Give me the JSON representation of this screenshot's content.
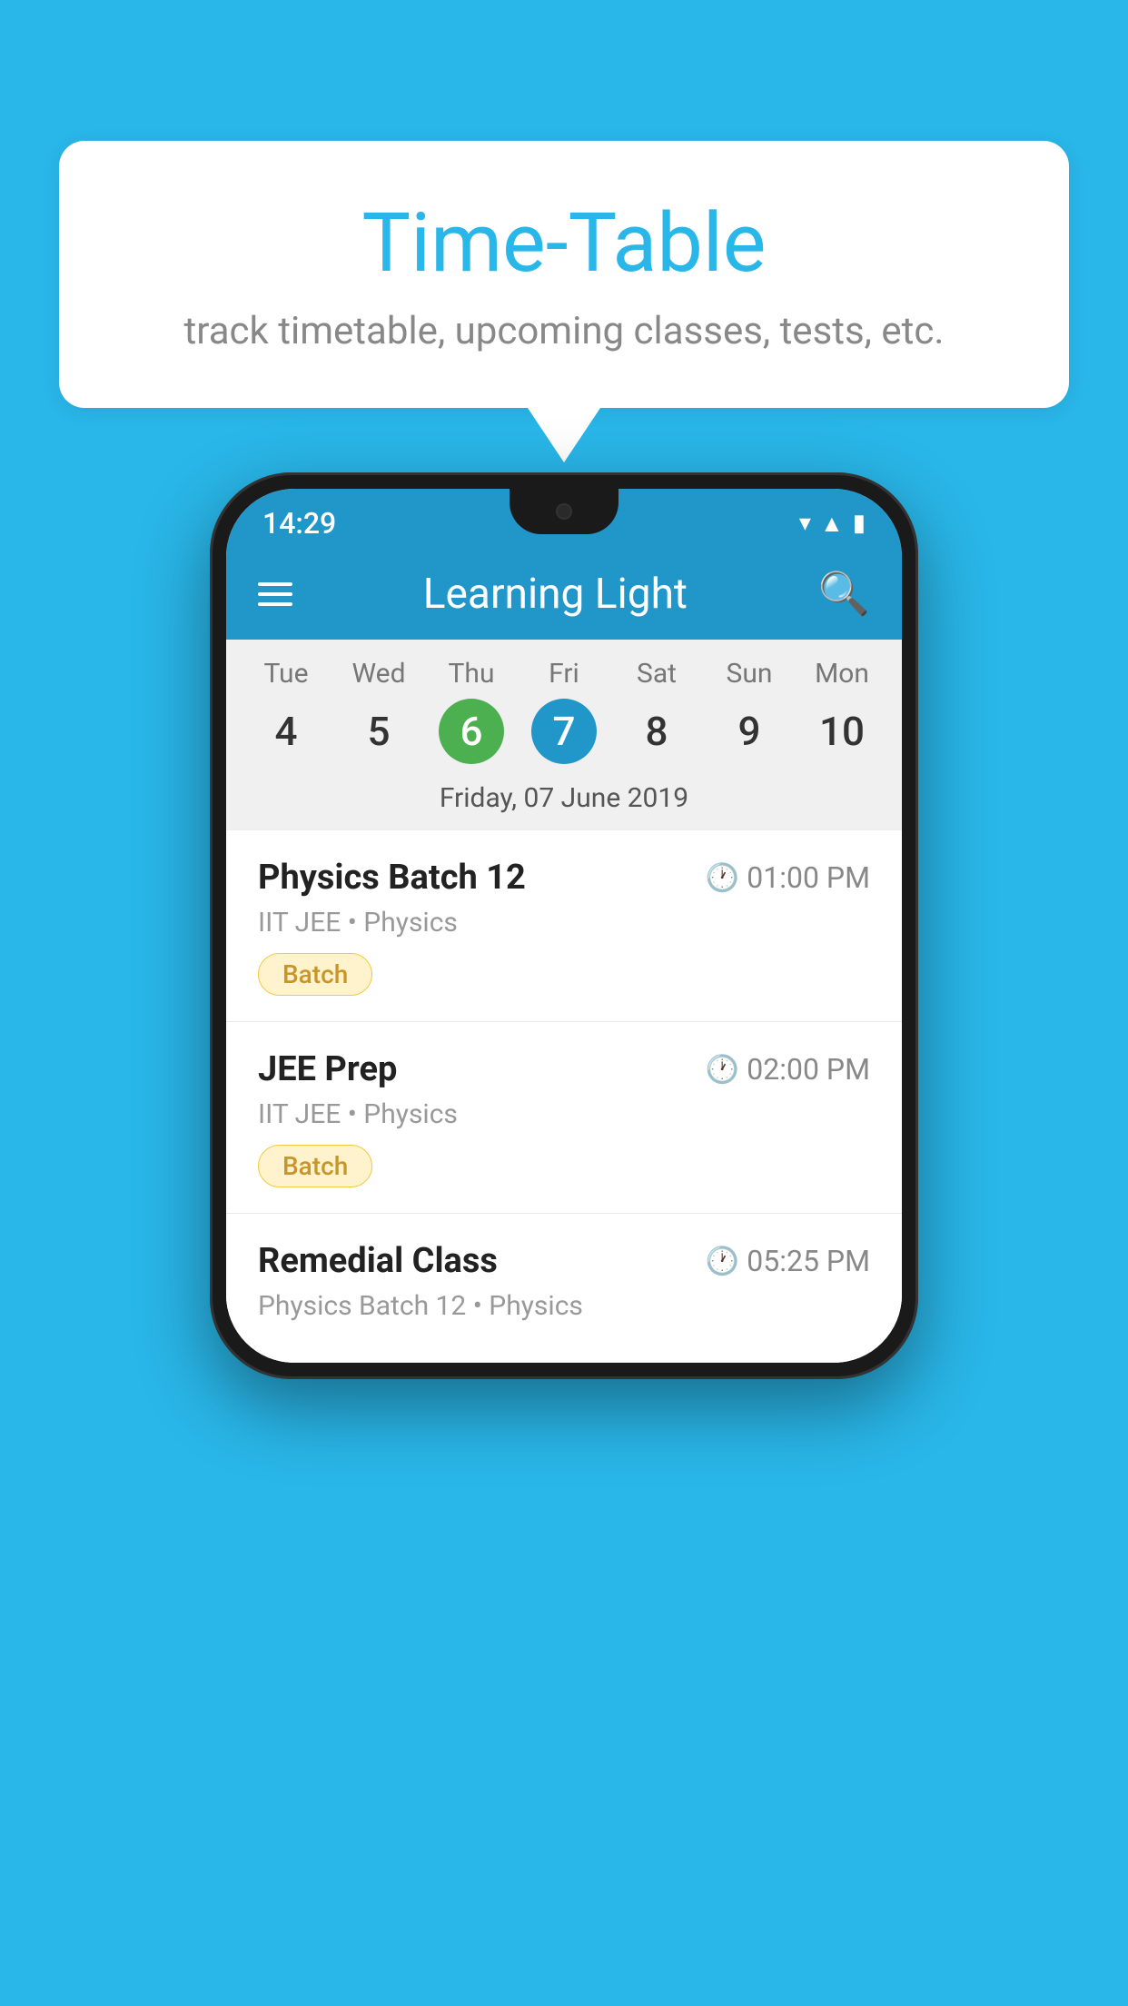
{
  "background_color": "#29B6E8",
  "speech_bubble": {
    "title": "Time-Table",
    "subtitle": "track timetable, upcoming classes, tests, etc."
  },
  "phone": {
    "status_bar": {
      "time": "14:29"
    },
    "toolbar": {
      "title": "Learning Light",
      "hamburger_label": "menu",
      "search_label": "search"
    },
    "calendar": {
      "days": [
        {
          "name": "Tue",
          "number": "4",
          "state": "normal"
        },
        {
          "name": "Wed",
          "number": "5",
          "state": "normal"
        },
        {
          "name": "Thu",
          "number": "6",
          "state": "today"
        },
        {
          "name": "Fri",
          "number": "7",
          "state": "selected"
        },
        {
          "name": "Sat",
          "number": "8",
          "state": "normal"
        },
        {
          "name": "Sun",
          "number": "9",
          "state": "normal"
        },
        {
          "name": "Mon",
          "number": "10",
          "state": "normal"
        }
      ],
      "selected_date_label": "Friday, 07 June 2019"
    },
    "schedule_items": [
      {
        "title": "Physics Batch 12",
        "time": "01:00 PM",
        "subtitle": "IIT JEE • Physics",
        "badge": "Batch"
      },
      {
        "title": "JEE Prep",
        "time": "02:00 PM",
        "subtitle": "IIT JEE • Physics",
        "badge": "Batch"
      },
      {
        "title": "Remedial Class",
        "time": "05:25 PM",
        "subtitle": "Physics Batch 12 • Physics",
        "badge": null
      }
    ]
  }
}
